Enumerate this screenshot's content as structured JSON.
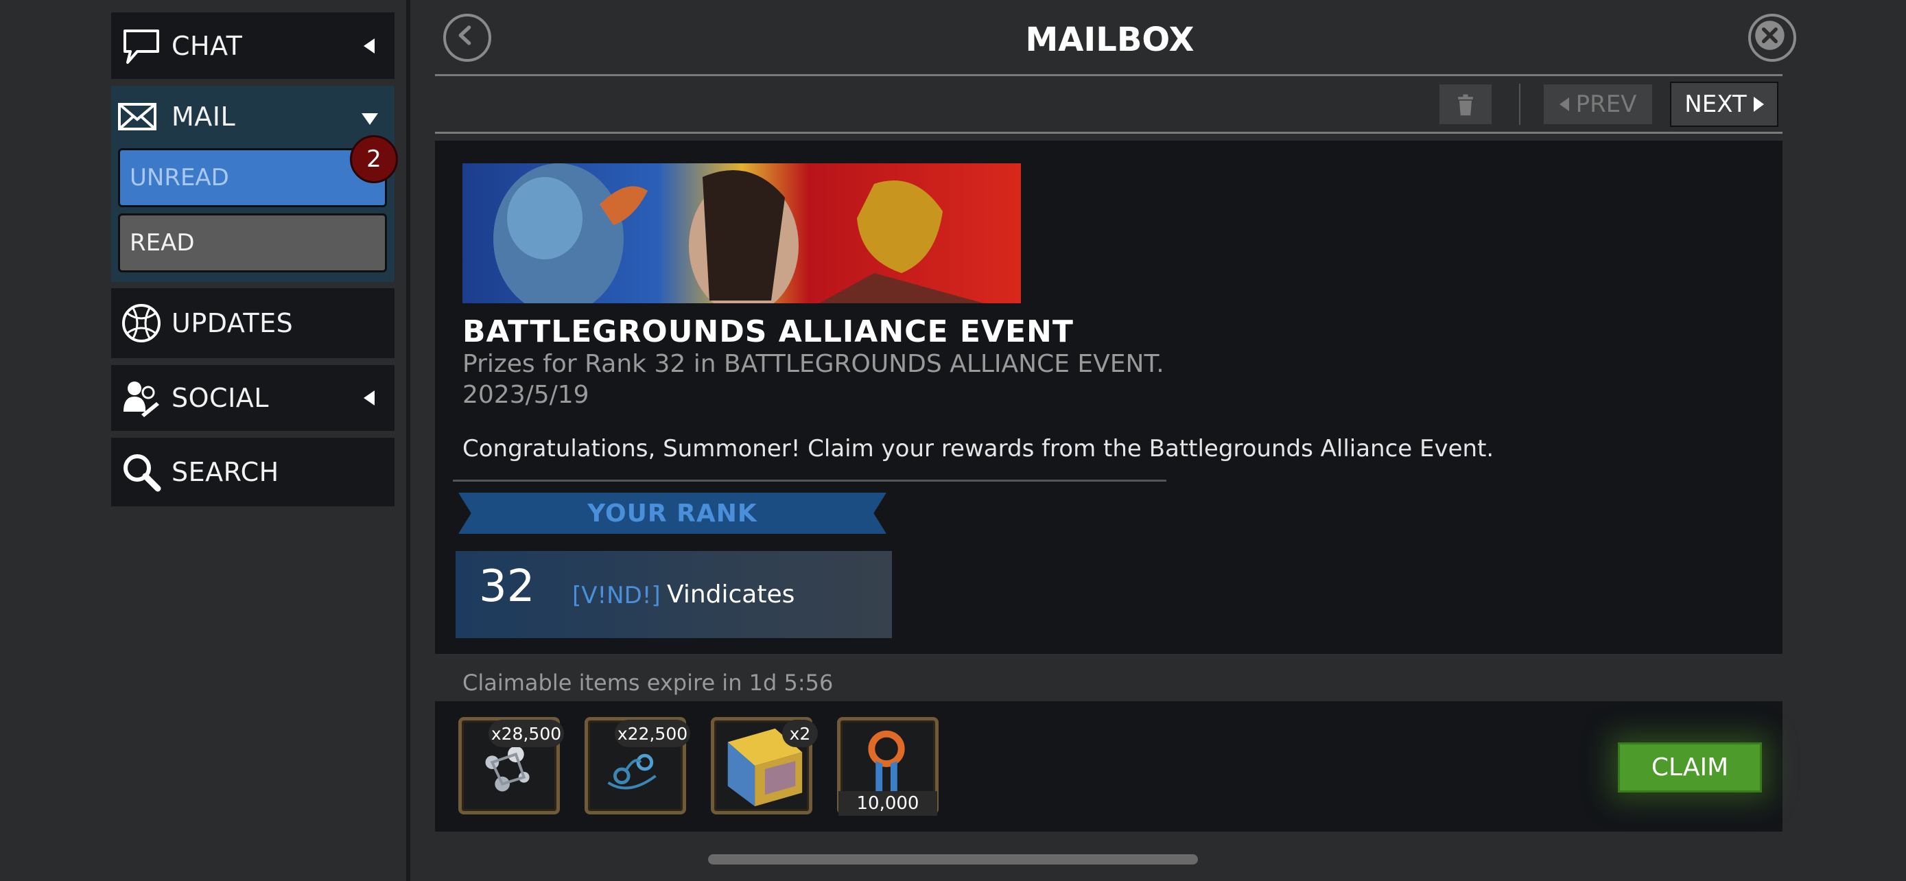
{
  "sidebar": {
    "chat": {
      "label": "CHAT"
    },
    "mail": {
      "label": "MAIL",
      "unread": "UNREAD",
      "read": "READ",
      "badge": "2"
    },
    "updates": {
      "label": "UPDATES"
    },
    "social": {
      "label": "SOCIAL"
    },
    "search": {
      "label": "SEARCH"
    }
  },
  "header": {
    "title": "MAILBOX",
    "prev_label": "PREV",
    "next_label": "NEXT"
  },
  "message": {
    "title": "BATTLEGROUNDS ALLIANCE EVENT",
    "subtitle": "Prizes for Rank 32 in BATTLEGROUNDS ALLIANCE EVENT.",
    "date": "2023/5/19",
    "body": "Congratulations, Summoner! Claim your rewards from the Battlegrounds Alliance Event.",
    "rank_header": "YOUR RANK",
    "rank": "32",
    "alliance_tag": "[V!ND!]",
    "alliance_name": "Vindicates"
  },
  "rewards": {
    "expire_text": "Claimable items expire in 1d 5:56",
    "items": [
      {
        "qty": "x28,500",
        "icon": "catalyst-shards-icon"
      },
      {
        "qty": "x22,500",
        "icon": "tech-shards-icon"
      },
      {
        "qty": "x2",
        "icon": "crystal-icon"
      },
      {
        "qty": "10,000",
        "icon": "alliance-loyalty-icon"
      }
    ],
    "claim_label": "CLAIM"
  },
  "colors": {
    "accent_blue": "#3c7ac9",
    "claim_green": "#4d9b2a",
    "badge_red": "#6e0a0a",
    "item_frame": "#6f5b3a"
  }
}
